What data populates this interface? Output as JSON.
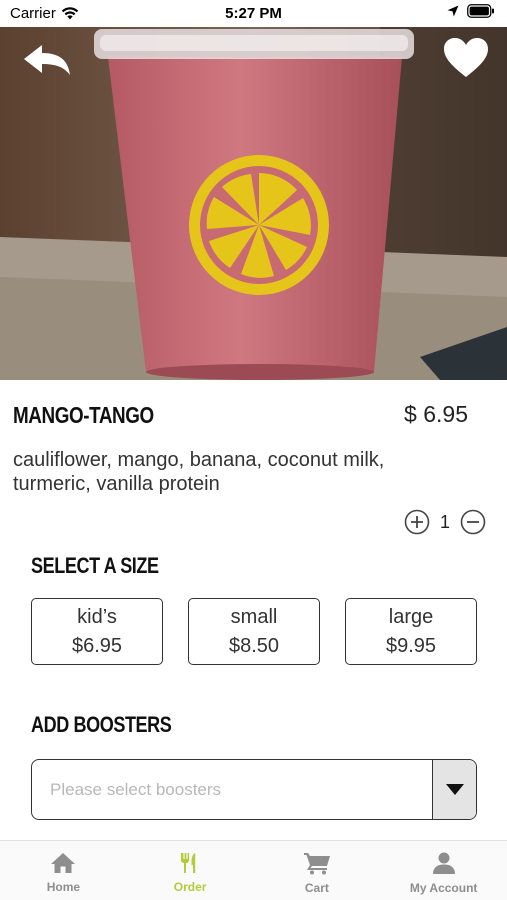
{
  "status_bar": {
    "carrier": "Carrier",
    "time": "5:27 PM"
  },
  "product": {
    "name": "MANGO-TANGO",
    "price": "$ 6.95",
    "description": "cauliflower, mango, banana, coconut milk, turmeric, vanilla protein",
    "quantity": "1"
  },
  "size_section": {
    "title": "SELECT A SIZE",
    "options": [
      {
        "label": "kid’s",
        "price": "$6.95"
      },
      {
        "label": "small",
        "price": "$8.50"
      },
      {
        "label": "large",
        "price": "$9.95"
      }
    ]
  },
  "boosters_section": {
    "title": "ADD BOOSTERS",
    "placeholder": "Please select boosters"
  },
  "tab_bar": {
    "active": "order",
    "tabs": [
      {
        "id": "home",
        "label": "Home",
        "icon": "home-icon"
      },
      {
        "id": "order",
        "label": "Order",
        "icon": "fork-knife-icon"
      },
      {
        "id": "cart",
        "label": "Cart",
        "icon": "cart-icon"
      },
      {
        "id": "account",
        "label": "My Account",
        "icon": "user-icon"
      }
    ]
  },
  "colors": {
    "accent": "#b4cc3a",
    "inactive_tab": "#8e8e8e",
    "logo_yellow": "#e6c51a",
    "smoothie_pink": "#c86a72"
  }
}
